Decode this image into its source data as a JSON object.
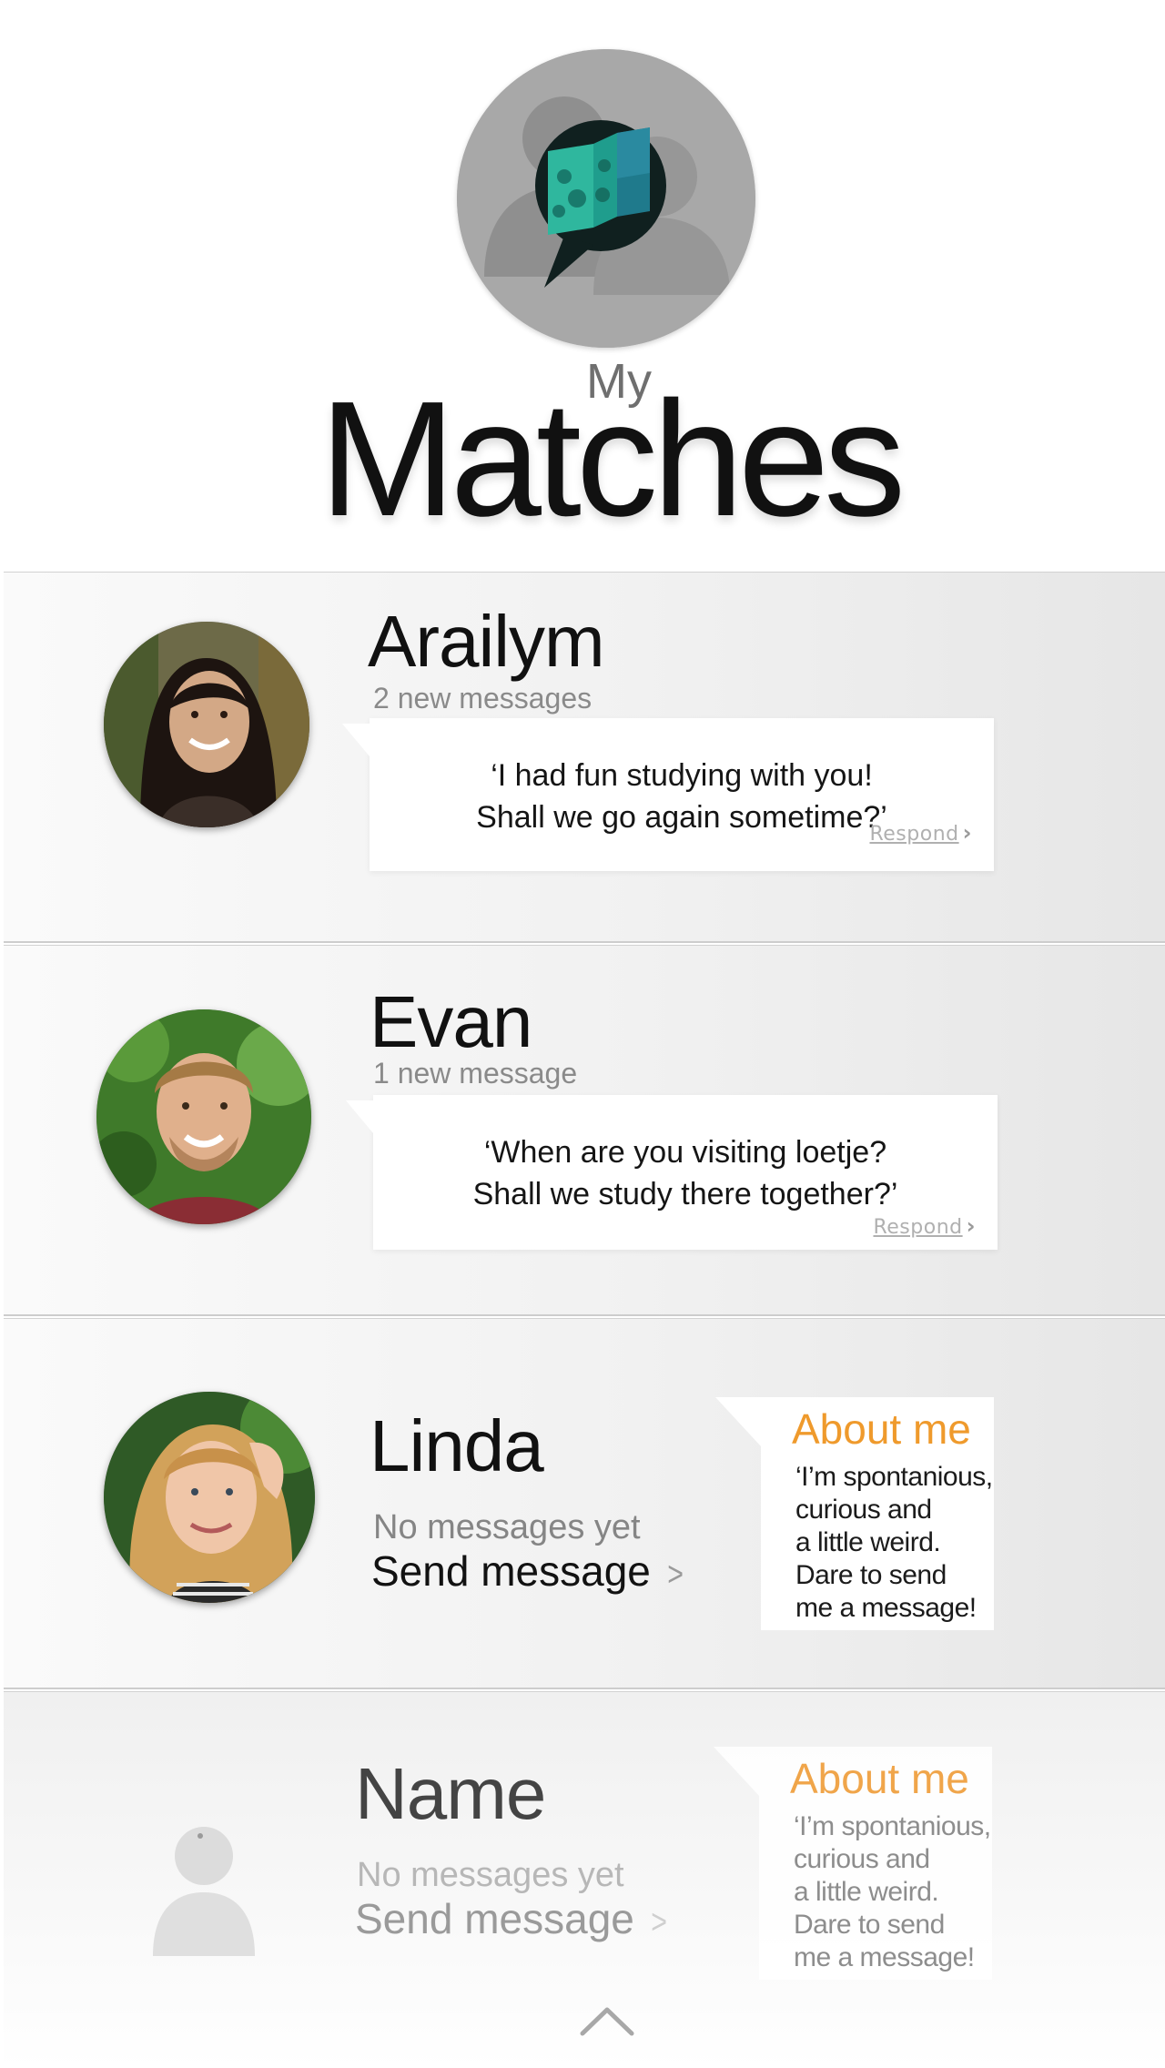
{
  "header": {
    "my_label": "My",
    "title": "Matches"
  },
  "matches": [
    {
      "name": "Arailym",
      "new_messages": "2 new messages",
      "message": "‘I had fun studying with you!\nShall we go again sometime?’",
      "respond_label": "Respond"
    },
    {
      "name": "Evan",
      "new_messages": "1 new message",
      "message": "‘When are you visiting loetje?\nShall we study there together?’",
      "respond_label": "Respond"
    },
    {
      "name": "Linda",
      "status": "No messages yet",
      "send_label": "Send message",
      "about_title": "About me",
      "about_text": "‘I’m spontanious,\ncurious and\na little weird.\nDare to send\nme a message!"
    },
    {
      "name": "Name",
      "status": "No messages yet",
      "send_label": "Send message",
      "about_title": "About me",
      "about_text": "‘I’m spontanious,\ncurious and\na little weird.\nDare to send\nme a message!"
    }
  ],
  "colors": {
    "accent": "#ef9a2c",
    "logo_teal": "#2bb39b",
    "logo_dark": "#0f2a2a"
  },
  "icons": {
    "logo": "app-logo-map-chat-icon",
    "chevron": "chevron-right-icon",
    "scroll_up": "chevron-up-icon",
    "placeholder": "person-placeholder-icon"
  }
}
